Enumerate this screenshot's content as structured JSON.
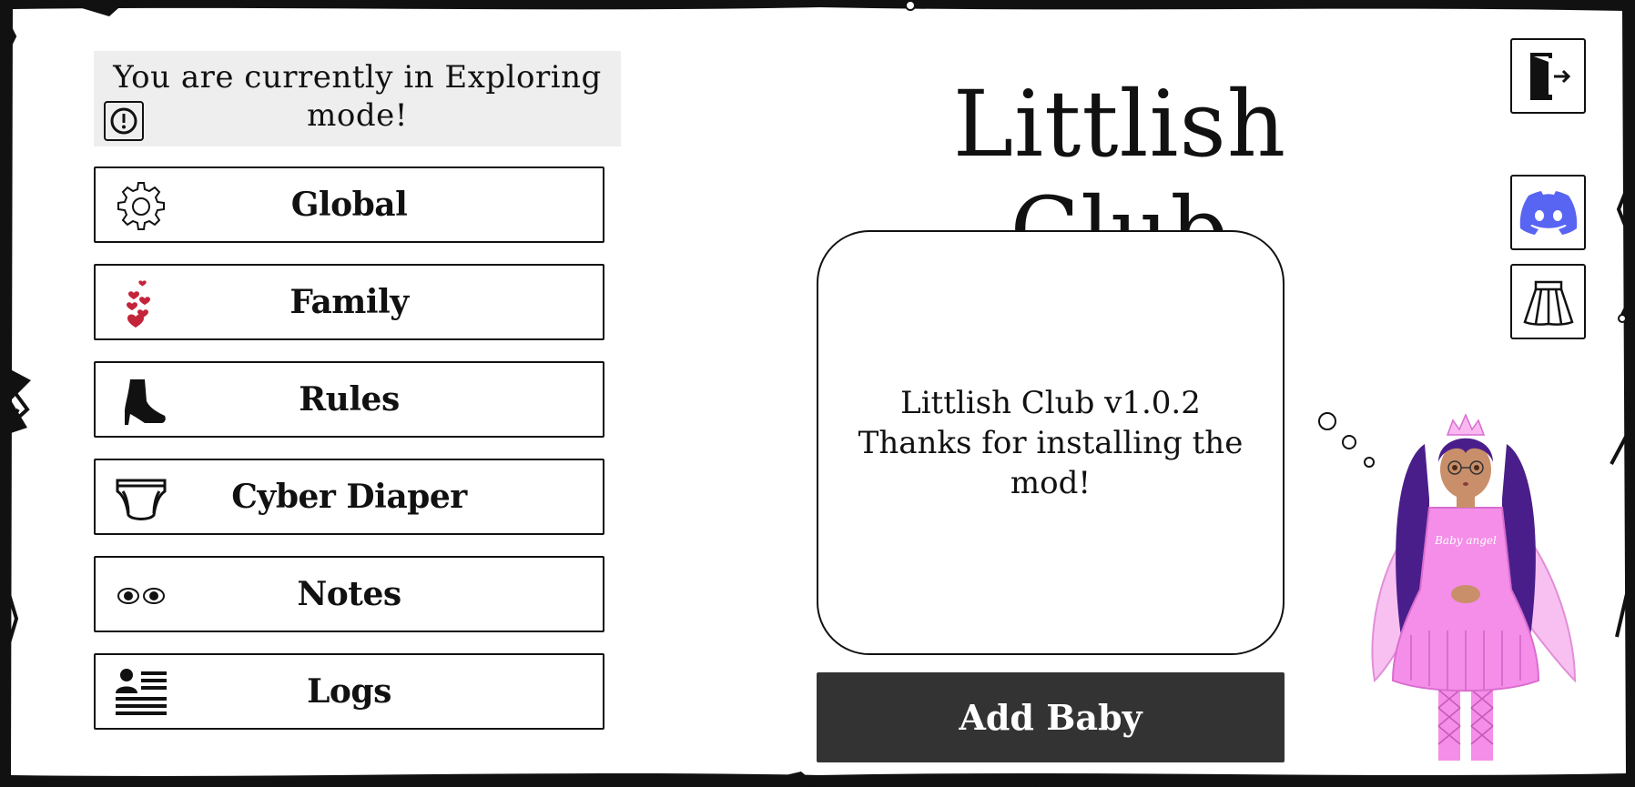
{
  "status": {
    "message": "You are currently in Exploring mode!",
    "icon": "exclamation-circle-icon"
  },
  "menu": [
    {
      "label": "Global",
      "icon": "gear-icon"
    },
    {
      "label": "Family",
      "icon": "hearts-icon"
    },
    {
      "label": "Rules",
      "icon": "high-heel-icon"
    },
    {
      "label": "Cyber Diaper",
      "icon": "diaper-icon"
    },
    {
      "label": "Notes",
      "icon": "eyes-icon"
    },
    {
      "label": "Logs",
      "icon": "log-list-icon"
    }
  ],
  "title": "Littlish Club",
  "info": {
    "version_line": "Littlish Club v1.0.2",
    "thanks_line": "Thanks for installing the mod!"
  },
  "add_button": {
    "label": "Add Baby"
  },
  "side_buttons": [
    {
      "icon": "exit-door-icon"
    },
    {
      "icon": "discord-icon",
      "color": "#5865F2"
    },
    {
      "icon": "skirt-icon"
    }
  ],
  "avatar": {
    "shirt_text": "Baby angel",
    "main_color": "#f48ee8",
    "hair_color": "#4a1e8a"
  },
  "colors": {
    "panel": "#eeeeee",
    "button_dark": "#333333",
    "heart": "#c4243a"
  }
}
